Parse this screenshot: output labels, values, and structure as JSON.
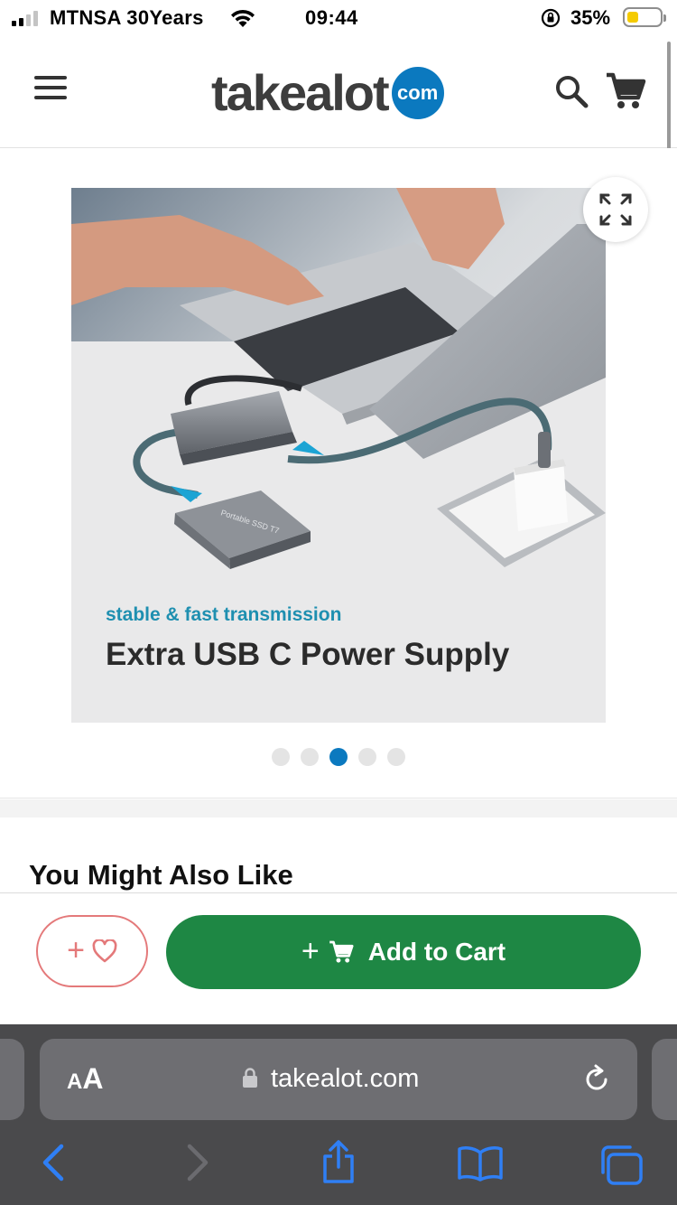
{
  "status_bar": {
    "carrier": "MTNSA 30Years",
    "time": "09:44",
    "battery_percent": "35%",
    "battery_level": 0.35
  },
  "header": {
    "logo_text": "takealot",
    "logo_badge": "com",
    "menu_icon": "hamburger-menu-icon",
    "search_icon": "search-icon",
    "cart_icon": "shopping-cart-icon"
  },
  "gallery": {
    "caption_small": "stable & fast transmission",
    "caption_large": "Extra USB C Power Supply",
    "ssd_label": "Portable SSD T7",
    "expand_icon": "fullscreen-expand-icon",
    "dots_total": 5,
    "dots_active_index": 2
  },
  "recommendations": {
    "title": "You Might Also Like"
  },
  "actions": {
    "wishlist_plus": "+",
    "wishlist_icon": "heart-icon",
    "add_to_cart_plus": "+",
    "add_to_cart_label": "Add to Cart"
  },
  "browser": {
    "aa_small": "A",
    "aa_large": "A",
    "url": "takealot.com",
    "toolbar": [
      "back-arrow-icon",
      "forward-arrow-icon",
      "share-icon",
      "bookmarks-icon",
      "tabs-icon"
    ]
  },
  "colors": {
    "brand_blue": "#0b79bf",
    "cart_green": "#1e8744",
    "wishlist_red": "#e4797a",
    "safari_blue": "#2f7ff5"
  }
}
